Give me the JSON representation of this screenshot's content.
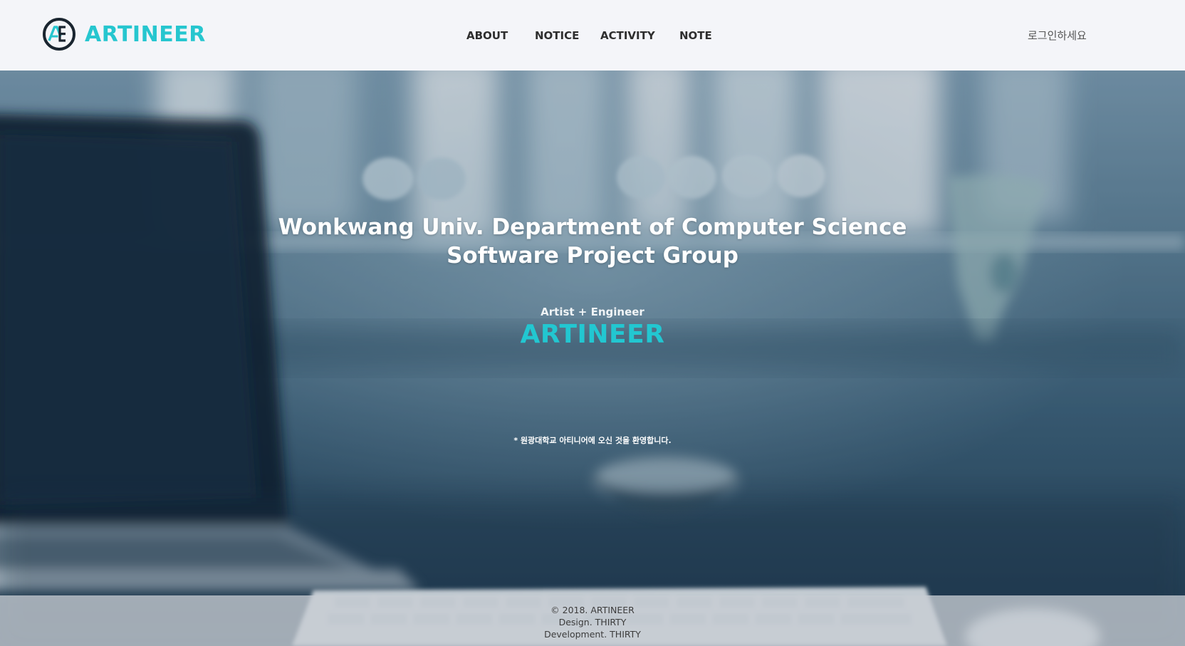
{
  "header": {
    "brand": "ARTINEER",
    "nav": {
      "about": "ABOUT",
      "notice": "NOTICE",
      "activity": "ACTIVITY",
      "note": "NOTE"
    },
    "login_label": "로그인하세요"
  },
  "hero": {
    "title_line1": "Wonkwang Univ. Department of Computer Science",
    "title_line2": "Software Project Group",
    "subtitle": "Artist + Engineer",
    "brand": "ARTINEER",
    "welcome": "* 원광대학교 아티니어에 오신 것을 환영합니다."
  },
  "footer": {
    "copyright": "© 2018. ARTINEER",
    "design": "Design. THIRTY",
    "development": "Development. THIRTY"
  },
  "colors": {
    "accent": "#26c6cf",
    "header_bg": "#f4f5f9",
    "logo_ring": "#1a2530"
  },
  "icons": {
    "logo": "ae-logo-icon"
  }
}
